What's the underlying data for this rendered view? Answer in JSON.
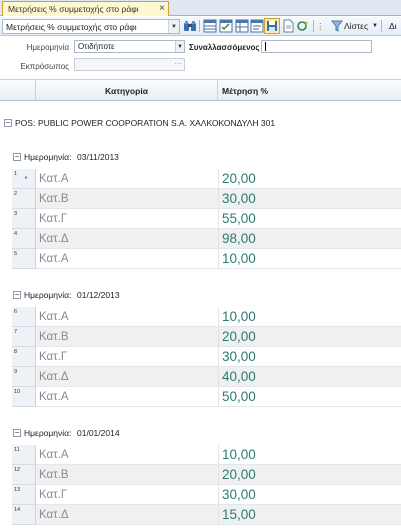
{
  "tab": {
    "title": "Μετρήσεις % συμμετοχής στο ράφι",
    "close": "×"
  },
  "toolbar": {
    "view_value": "Μετρήσεις % συμμετοχής στο ράφι",
    "lists_label": "Λίστες",
    "more_label": "Δι"
  },
  "filters": {
    "date_label": "Ημερομηνία",
    "date_value": "Οτιδήποτε",
    "counterparty_label": "Συναλλασσόμενος",
    "counterparty_value": "",
    "representative_label": "Εκπρόσωπος",
    "representative_value": ""
  },
  "grid": {
    "columns": [
      "Κατηγορία",
      "Μέτρηση %"
    ],
    "pos_group_label": "POS:",
    "pos_group_value": "PUBLIC POWER COOPORATION S.A. ΧΑΛΚΟΚΟΝΔΥΛΗ 301",
    "date_group_prefix": "Ημερομηνία:",
    "groups": [
      {
        "date": "03/11/2013",
        "rows": [
          {
            "n": "1",
            "cat": "Κατ.Α",
            "val": "20,00"
          },
          {
            "n": "2",
            "cat": "Κατ.Β",
            "val": "30,00"
          },
          {
            "n": "3",
            "cat": "Κατ.Γ",
            "val": "55,00"
          },
          {
            "n": "4",
            "cat": "Κατ.Δ",
            "val": "98,00"
          },
          {
            "n": "5",
            "cat": "Κατ.Α",
            "val": "10,00"
          }
        ]
      },
      {
        "date": "01/12/2013",
        "rows": [
          {
            "n": "6",
            "cat": "Κατ.Α",
            "val": "10,00"
          },
          {
            "n": "7",
            "cat": "Κατ.Β",
            "val": "20,00"
          },
          {
            "n": "8",
            "cat": "Κατ.Γ",
            "val": "30,00"
          },
          {
            "n": "9",
            "cat": "Κατ.Δ",
            "val": "40,00"
          },
          {
            "n": "10",
            "cat": "Κατ.Α",
            "val": "50,00"
          }
        ]
      },
      {
        "date": "01/01/2014",
        "rows": [
          {
            "n": "11",
            "cat": "Κατ.Α",
            "val": "10,00"
          },
          {
            "n": "12",
            "cat": "Κατ.Β",
            "val": "20,00"
          },
          {
            "n": "13",
            "cat": "Κατ.Γ",
            "val": "30,00"
          },
          {
            "n": "14",
            "cat": "Κατ.Δ",
            "val": "15,00"
          }
        ]
      }
    ]
  },
  "colors": {
    "value_text": "#2f7a72",
    "category_text": "#8a8a8a",
    "tab_active": "#fff7d0"
  }
}
